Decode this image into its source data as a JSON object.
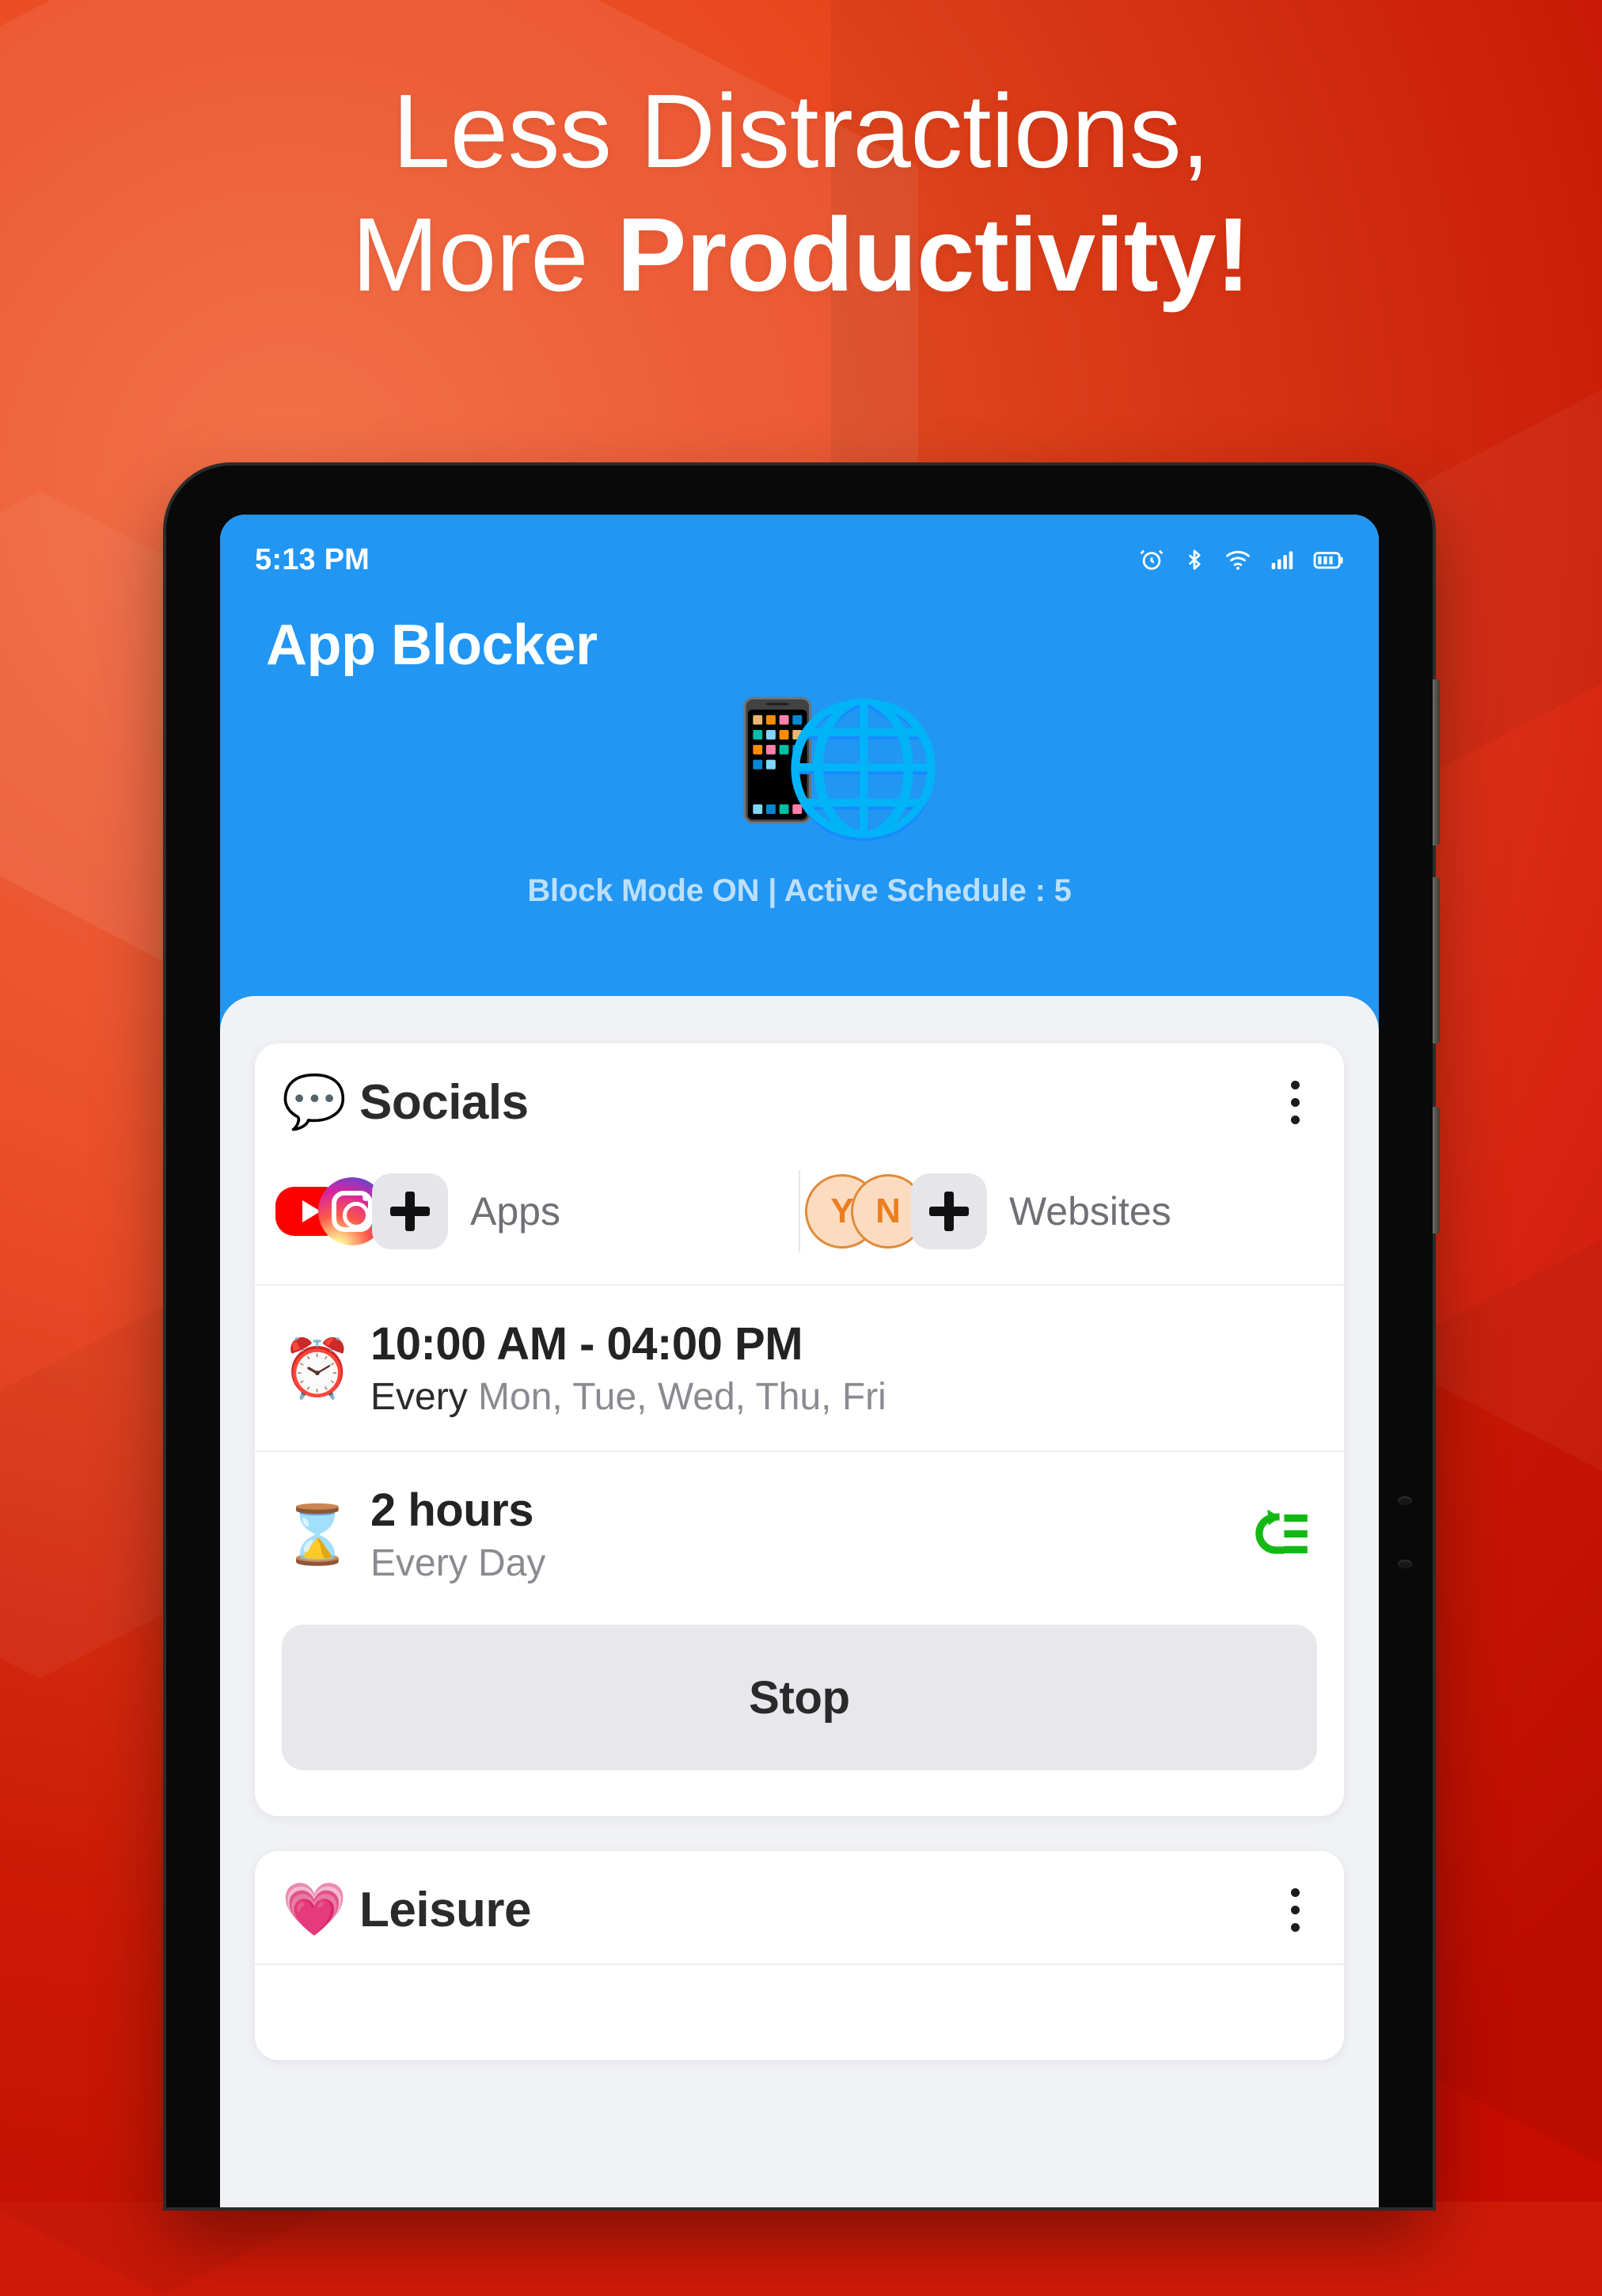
{
  "promo": {
    "headline_line1": "Less Distractions,",
    "headline_line2_regular": "More ",
    "headline_line2_bold": "Productivity!",
    "background_color": "#e8441c",
    "accent_color": "#2196f3"
  },
  "status_bar": {
    "time": "5:13 PM",
    "icons": [
      "alarm-icon",
      "bluetooth-icon",
      "wifi-icon",
      "signal-icon",
      "battery-icon"
    ]
  },
  "app": {
    "title": "App Blocker",
    "hero_emoji_phone": "📱",
    "hero_emoji_globe": "🌐",
    "block_status": "Block Mode ON | Active Schedule : 5"
  },
  "cards": [
    {
      "emoji": "💬",
      "title": "Socials",
      "apps": {
        "icons": [
          "youtube-icon",
          "instagram-icon"
        ],
        "add_label": "+",
        "label": "Apps"
      },
      "websites": {
        "icons": [
          "Y",
          "N"
        ],
        "add_label": "+",
        "label": "Websites"
      },
      "schedule": {
        "emoji": "⏰",
        "time_range": "10:00 AM - 04:00 PM",
        "repeat_prefix": "Every ",
        "repeat_days": "Mon, Tue, Wed, Thu, Fri"
      },
      "duration": {
        "emoji": "⌛",
        "amount": "2 hours",
        "frequency": "Every Day",
        "reset_icon": "reset-repeat-icon",
        "reset_icon_color": "#14b814"
      },
      "action_button": "Stop"
    },
    {
      "emoji": "💗",
      "title": "Leisure"
    }
  ]
}
